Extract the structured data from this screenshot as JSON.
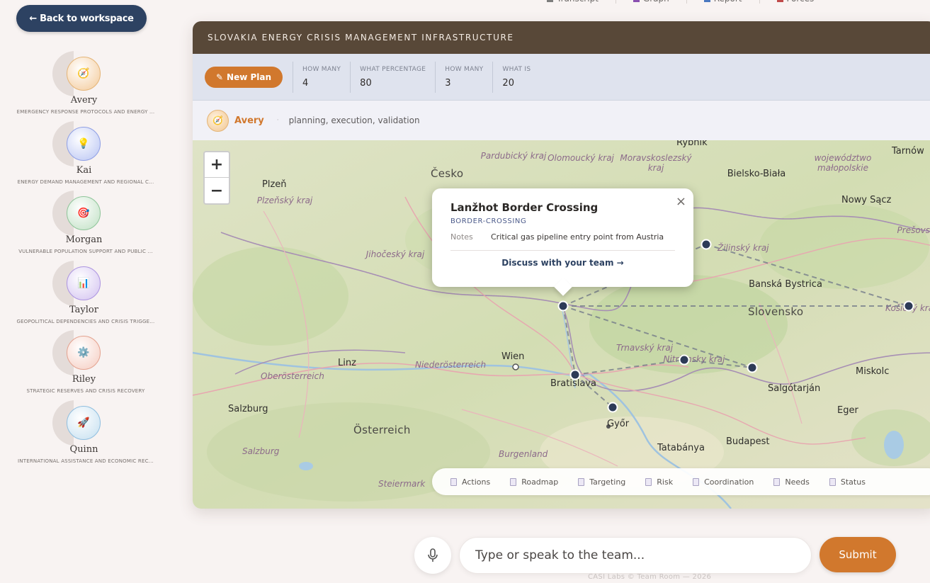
{
  "top_nav": [
    {
      "label": "Transcript",
      "icon": "transcript-icon",
      "color": "#7d7d7d"
    },
    {
      "label": "Graph",
      "icon": "graph-icon",
      "color": "#8a4fb0"
    },
    {
      "label": "Report",
      "icon": "report-icon",
      "color": "#4a78c0"
    },
    {
      "label": "Forces",
      "icon": "forces-icon",
      "color": "#c04a4a"
    }
  ],
  "sidebar": {
    "back_label": "← Back to workspace",
    "agents": [
      {
        "name": "Avery",
        "role": "EMERGENCY RESPONSE PROTOCOLS AND ENERGY ...",
        "icon": "compass-icon",
        "glyph": "🧭",
        "color": "#f3c998",
        "border": "#e4b476"
      },
      {
        "name": "Kai",
        "role": "ENERGY DEMAND MANAGEMENT AND REGIONAL C...",
        "icon": "lightbulb-icon",
        "glyph": "💡",
        "color": "#b8c4f3",
        "border": "#8f9fe4"
      },
      {
        "name": "Morgan",
        "role": "VULNERABLE POPULATION SUPPORT AND PUBLIC ...",
        "icon": "target-icon",
        "glyph": "🎯",
        "color": "#bfe0c3",
        "border": "#8ec499"
      },
      {
        "name": "Taylor",
        "role": "GEOPOLITICAL DEPENDENCIES AND CRISIS TRIGGE...",
        "icon": "bar-chart-icon",
        "glyph": "📊",
        "color": "#d2c1f0",
        "border": "#ac94e0"
      },
      {
        "name": "Riley",
        "role": "STRATEGIC RESERVES AND CRISIS RECOVERY",
        "icon": "gear-icon",
        "glyph": "⚙️",
        "color": "#f5ccc0",
        "border": "#e3a28f"
      },
      {
        "name": "Quinn",
        "role": "INTERNATIONAL ASSISTANCE AND ECONOMIC REC...",
        "icon": "rocket-icon",
        "glyph": "🚀",
        "color": "#c4dff0",
        "border": "#8fbedf"
      }
    ]
  },
  "card": {
    "title": "SLOVAKIA ENERGY CRISIS MANAGEMENT INFRASTRUCTURE",
    "new_plan_label": "New Plan",
    "stats": [
      {
        "label": "HOW MANY",
        "value": "4"
      },
      {
        "label": "WHAT PERCENTAGE",
        "value": "80"
      },
      {
        "label": "HOW MANY",
        "value": "3"
      },
      {
        "label": "WHAT IS",
        "value": "20"
      }
    ],
    "active_agent": {
      "name": "Avery",
      "glyph": "🧭",
      "desc": "planning, execution, validation"
    }
  },
  "map": {
    "zoom_in": "+",
    "zoom_out": "−",
    "labels": [
      {
        "text": "Česko",
        "kind": "country"
      },
      {
        "text": "Slovensko",
        "kind": "country"
      },
      {
        "text": "Österreich",
        "kind": "country"
      },
      {
        "text": "Wien",
        "kind": "city"
      },
      {
        "text": "Bratislava",
        "kind": "city"
      },
      {
        "text": "Budapest",
        "kind": "city"
      },
      {
        "text": "Linz",
        "kind": "city"
      },
      {
        "text": "Plzeň",
        "kind": "city"
      },
      {
        "text": "Salzburg",
        "kind": "city"
      },
      {
        "text": "Győr",
        "kind": "city"
      },
      {
        "text": "Tatabánya",
        "kind": "city"
      },
      {
        "text": "Banská Bystrica",
        "kind": "city"
      },
      {
        "text": "Bielsko-Biała",
        "kind": "city"
      },
      {
        "text": "Nowy Sącz",
        "kind": "city"
      },
      {
        "text": "Tarnów",
        "kind": "city"
      },
      {
        "text": "Salgótarján",
        "kind": "city"
      },
      {
        "text": "Miskolc",
        "kind": "city"
      },
      {
        "text": "Eger",
        "kind": "city"
      },
      {
        "text": "Rybnik",
        "kind": "city"
      },
      {
        "text": "Pardubický kraj",
        "kind": "region"
      },
      {
        "text": "Olomoucký kraj",
        "kind": "region"
      },
      {
        "text": "Moravskoslezský kraj",
        "kind": "region"
      },
      {
        "text": "województwo małopolskie",
        "kind": "region"
      },
      {
        "text": "Plzeňský kraj",
        "kind": "region"
      },
      {
        "text": "Jihočeský kraj",
        "kind": "region"
      },
      {
        "text": "Žilinský kraj",
        "kind": "region"
      },
      {
        "text": "Prešovský kraj",
        "kind": "region"
      },
      {
        "text": "Košický kraj",
        "kind": "region"
      },
      {
        "text": "Trnavský kraj",
        "kind": "region"
      },
      {
        "text": "Nitriansky kraj",
        "kind": "region"
      },
      {
        "text": "Niederösterreich",
        "kind": "region"
      },
      {
        "text": "Oberösterreich",
        "kind": "region"
      },
      {
        "text": "Burgenland",
        "kind": "region"
      },
      {
        "text": "Steiermark",
        "kind": "region"
      },
      {
        "text": "Salzburg",
        "kind": "region"
      }
    ],
    "popup": {
      "title": "Lanžhot Border Crossing",
      "type": "BORDER-CROSSING",
      "notes_label": "Notes",
      "notes_value": "Critical gas pipeline entry point from Austria",
      "link": "Discuss with your team →",
      "close": "×"
    },
    "tabs": [
      "Actions",
      "Roadmap",
      "Targeting",
      "Risk",
      "Coordination",
      "Needs",
      "Status"
    ]
  },
  "chat": {
    "placeholder": "Type or speak to the team...",
    "submit_label": "Submit"
  },
  "footer": "CASI Labs © Team Room — 2026",
  "colors": {
    "accent": "#d1782d",
    "navy": "#2d4262",
    "header_brown": "#584838",
    "marker": "#2d3b57"
  }
}
